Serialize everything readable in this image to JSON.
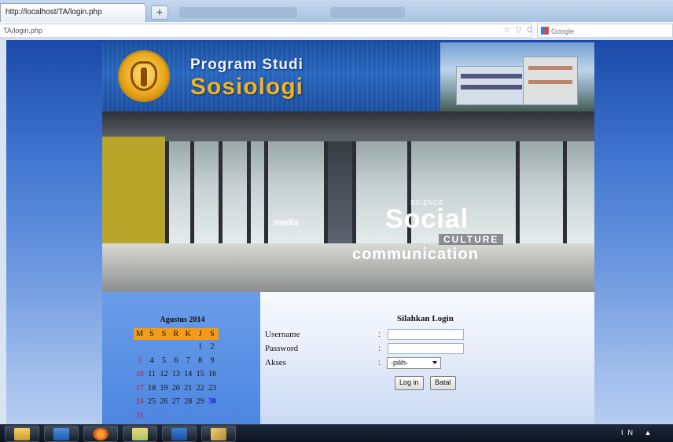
{
  "browser": {
    "tab_title": "http://localhost/TA/login.php",
    "new_tab_label": "+",
    "url": "TA/login.php",
    "url_tools": "☆ ▽ C",
    "search_placeholder": "Google"
  },
  "banner": {
    "line1": "Program Studi",
    "line2": "Sosiologi"
  },
  "photo_decals": {
    "social": "Social",
    "culture": "CULTURE",
    "communication": "communication",
    "media": "media",
    "science": "SCIENCE"
  },
  "calendar": {
    "title": "Agustus 2014",
    "weekdays": [
      "M",
      "S",
      "S",
      "R",
      "K",
      "J",
      "S"
    ],
    "weeks": [
      [
        "",
        "",
        "",
        "",
        "",
        "1",
        "2"
      ],
      [
        "3",
        "4",
        "5",
        "6",
        "7",
        "8",
        "9"
      ],
      [
        "10",
        "11",
        "12",
        "13",
        "14",
        "15",
        "16"
      ],
      [
        "17",
        "18",
        "19",
        "20",
        "21",
        "22",
        "23"
      ],
      [
        "24",
        "25",
        "26",
        "27",
        "28",
        "29",
        "30"
      ],
      [
        "31",
        "",
        "",
        "",
        "",
        "",
        ""
      ]
    ],
    "today": "30",
    "colors": {
      "header": "#f39a16",
      "sunday": "#c8102e",
      "today": "#1a1ad0"
    }
  },
  "login": {
    "title": "Silahkan Login",
    "username_label": "Username",
    "password_label": "Password",
    "akses_label": "Akses",
    "colon": ":",
    "akses_selected": "-pilih-",
    "login_button": "Log in",
    "cancel_button": "Batal"
  },
  "taskbar": {
    "tray_text": "IN ▲"
  }
}
